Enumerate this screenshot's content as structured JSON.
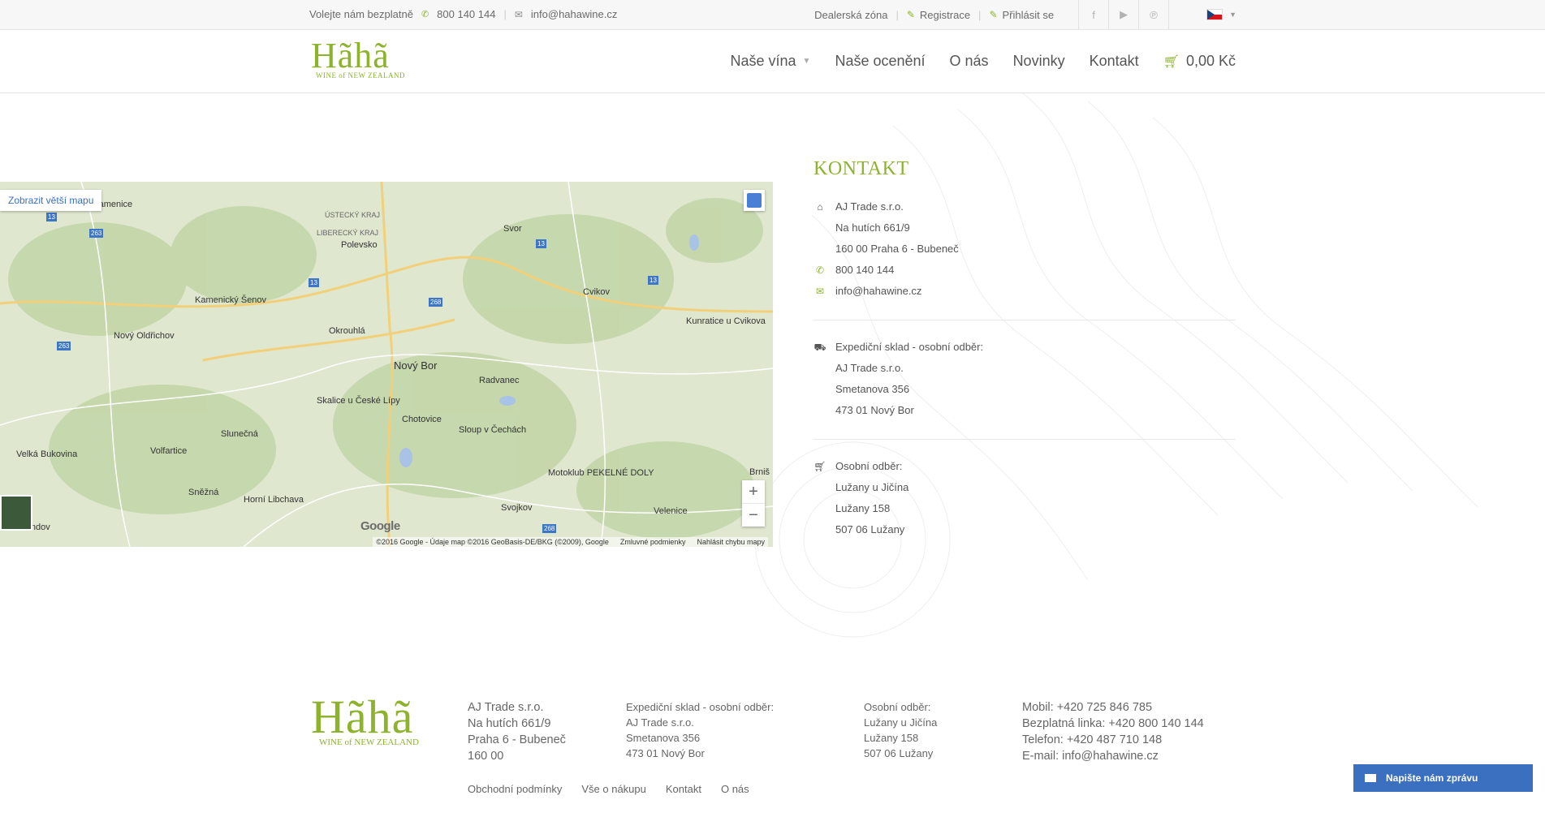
{
  "topbar": {
    "call_text": "Volejte nám bezplatně",
    "phone": "800 140 144",
    "email": "info@hahawine.cz",
    "links": [
      "Dealerská zóna",
      "Registrace",
      "Přihlásit se"
    ]
  },
  "header": {
    "logo_main": "Hãhã",
    "logo_sub": "WINE of NEW ZEALAND",
    "nav": [
      "Naše vína",
      "Naše ocenění",
      "O nás",
      "Novinky",
      "Kontakt"
    ],
    "cart": "0,00 Kč"
  },
  "map": {
    "link": "Zobrazit větší mapu",
    "footer": [
      "©2016 Google - Údaje map ©2016 GeoBasis-DE/BKG (©2009), Google",
      "Zmluvné podmienky",
      "Nahlásit chybu mapy"
    ],
    "google": "Google",
    "places": [
      "Česká Kamenice",
      "Svor",
      "Polevsko",
      "Kamenický Šenov",
      "Nový Oldřichov",
      "Okrouhlá",
      "Nový Bor",
      "Cvikov",
      "Kunratice u Cvikova",
      "Radvanec",
      "Skalice u České Lípy",
      "Chotovice",
      "Sloup v Čechách",
      "Slunečná",
      "Velká Bukovina",
      "Volfartice",
      "Sněžná",
      "Horní Libchava",
      "Zandov",
      "Motoklub PEKELNÉ DOLY",
      "Svojkov",
      "Velenice",
      "Brniš",
      "ÚSTECKÝ KRAJ",
      "LIBERECKÝ KRAJ"
    ]
  },
  "kontakt": {
    "title": "KONTAKT",
    "company": "AJ Trade s.r.o.",
    "street": "Na hutích 661/9",
    "city": "160 00 Praha 6 - Bubeneč",
    "phone": "800 140 144",
    "email": "info@hahawine.cz",
    "sklad_title": "Expediční sklad - osobní odběr:",
    "sklad_company": "AJ Trade s.r.o.",
    "sklad_street": "Smetanova 356",
    "sklad_city": "473 01 Nový Bor",
    "odber_title": "Osobní odběr:",
    "odber_place": "Lužany u Jičína",
    "odber_street": "Lužany 158",
    "odber_city": "507 06 Lužany"
  },
  "footer": {
    "logo_main": "Hãhã",
    "logo_sub": "WINE of NEW ZEALAND",
    "col1": [
      "AJ Trade s.r.o.",
      "Na hutích 661/9",
      "Praha 6 - Bubeneč",
      "160 00"
    ],
    "col2": [
      "Expediční sklad - osobní odběr:",
      "AJ Trade s.r.o.",
      "Smetanova 356",
      "473 01 Nový Bor"
    ],
    "col3": [
      "Osobní odběr:",
      "Lužany u Jičína",
      "Lužany 158",
      "507 06 Lužany"
    ],
    "col4": [
      "Mobil: +420 725 846 785",
      "Bezplatná linka: +420 800 140 144",
      "Telefon: +420 487 710 148",
      "E-mail: info@hahawine.cz"
    ],
    "links": [
      "Obchodní podmínky",
      "Vše o nákupu",
      "Kontakt",
      "O nás"
    ]
  },
  "chat": {
    "label": "Napište nám zprávu"
  }
}
